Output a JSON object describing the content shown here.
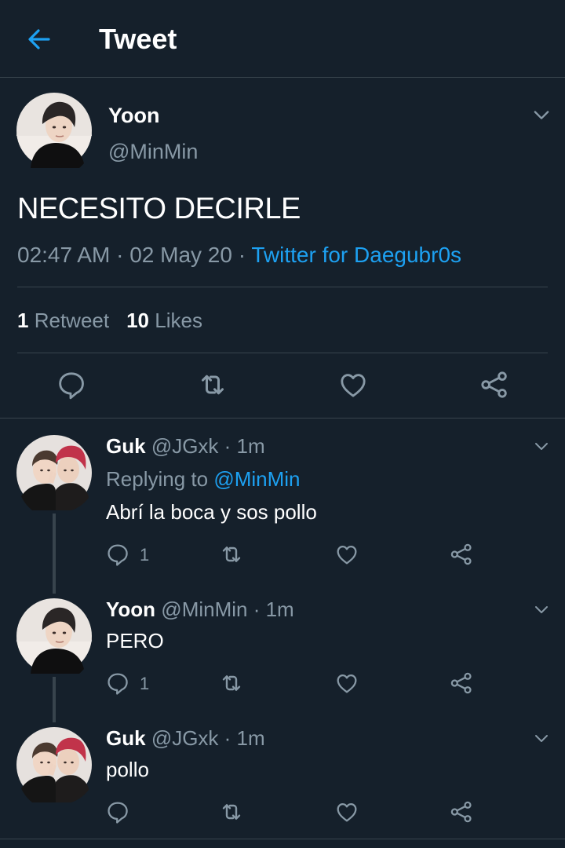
{
  "header": {
    "title": "Tweet"
  },
  "tweet": {
    "name": "Yoon",
    "handle": "@MinMin",
    "text": "NECESITO DECIRLE",
    "time": "02:47 AM",
    "date": "02 May 20",
    "separator": "·",
    "source": "Twitter for Daegubr0s",
    "retweet_count": "1",
    "retweet_label": "Retweet",
    "like_count": "10",
    "like_label": "Likes"
  },
  "replies": [
    {
      "name": "Guk",
      "handle": "@JGxk",
      "time": "· 1m",
      "replying_prefix": "Replying to",
      "replying_to": "@MinMin",
      "text": "Abrí la boca y sos pollo",
      "reply_count": "1"
    },
    {
      "name": "Yoon",
      "handle": "@MinMin",
      "time": "· 1m",
      "text": "PERO",
      "reply_count": "1"
    },
    {
      "name": "Guk",
      "handle": "@JGxk",
      "time": "· 1m",
      "text": "pollo",
      "reply_count": ""
    }
  ],
  "colors": {
    "background": "#15202b",
    "muted": "#8899a6",
    "accent": "#1da1f2",
    "divider": "#38444d"
  },
  "icons": {
    "back": "arrow-left-icon",
    "reply": "speech-bubble-icon",
    "retweet": "retweet-icon",
    "like": "heart-icon",
    "share": "share-icon",
    "more": "chevron-down-icon"
  }
}
